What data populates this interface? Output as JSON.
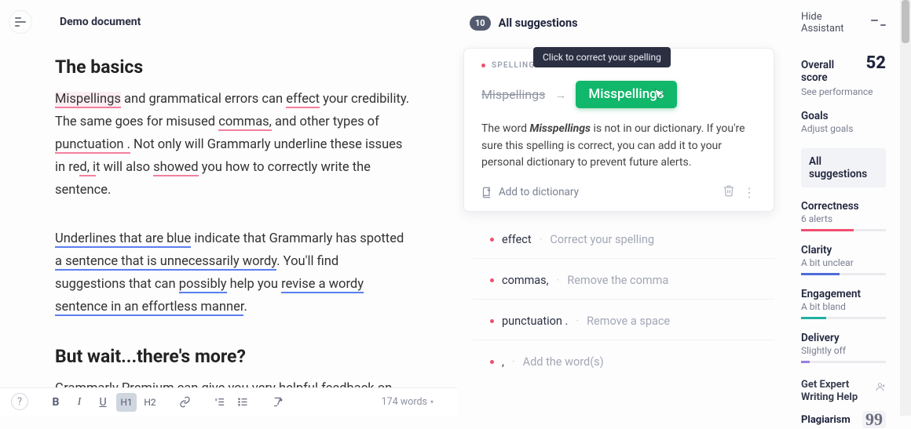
{
  "header": {
    "title": "Demo document"
  },
  "editor": {
    "h1": "The basics",
    "p1_segs": {
      "s1": "Mispellings",
      "t1": " and grammatical errors can ",
      "s2": "effect",
      "t2": " your credibility. The same goes for misused ",
      "s3": "commas,",
      "t3": " and other types of ",
      "s4": "punctuation .",
      "t4": " Not only will Grammarly underline these issues in re",
      "s5": "d, i",
      "t5": "t will also ",
      "s6": "showed",
      "t6": " you how to correctly write the sentence."
    },
    "p2_segs": {
      "b1": "Underlines that are blue",
      "t1": " indicate that Grammarly has spotted ",
      "b2": "a sentence that is unnecessarily wordy",
      "t2": ". You'll find suggestions that can ",
      "b3": "possibly",
      "t3": " help you ",
      "b4": "revise a wordy sentence in an effortless manner",
      "t4": "."
    },
    "h2": "But wait...there's more?",
    "p3": "Grammarly Premium can give you very helpful feedback on your"
  },
  "footer": {
    "tools": {
      "bold": "B",
      "italic": "I",
      "underline": "U",
      "h1": "H1",
      "h2": "H2"
    },
    "wordcount": "174 words"
  },
  "suggestions": {
    "count": "10",
    "title": "All suggestions",
    "card": {
      "category": "SPELLING",
      "tooltip": "Click to correct your spelling",
      "wrong": "Mispellings",
      "right": "Misspellings",
      "explain_pre": "The word ",
      "explain_em": "Misspellings",
      "explain_post": " is not in our dictionary. If you're sure this spelling is correct, you can add it to your personal dictionary to prevent future alerts.",
      "add_dict": "Add to dictionary"
    },
    "list": [
      {
        "term": "effect",
        "hint": "Correct your spelling"
      },
      {
        "term": "commas,",
        "hint": "Remove the comma"
      },
      {
        "term": "punctuation .",
        "hint": "Remove a space"
      },
      {
        "term": ",",
        "hint": "Add the word(s)"
      }
    ]
  },
  "sidebar": {
    "hide": "Hide Assistant",
    "overall_label": "Overall score",
    "overall_value": "52",
    "see_perf": "See performance",
    "goals_label": "Goals",
    "goals_sub": "Adjust goals",
    "all_sugg": "All suggestions",
    "metrics": {
      "correctness_t": "Correctness",
      "correctness_s": "6 alerts",
      "clarity_t": "Clarity",
      "clarity_s": "A bit unclear",
      "engagement_t": "Engagement",
      "engagement_s": "A bit bland",
      "delivery_t": "Delivery",
      "delivery_s": "Slightly off"
    },
    "expert": "Get Expert Writing Help",
    "plagiarism": "Plagiarism"
  }
}
